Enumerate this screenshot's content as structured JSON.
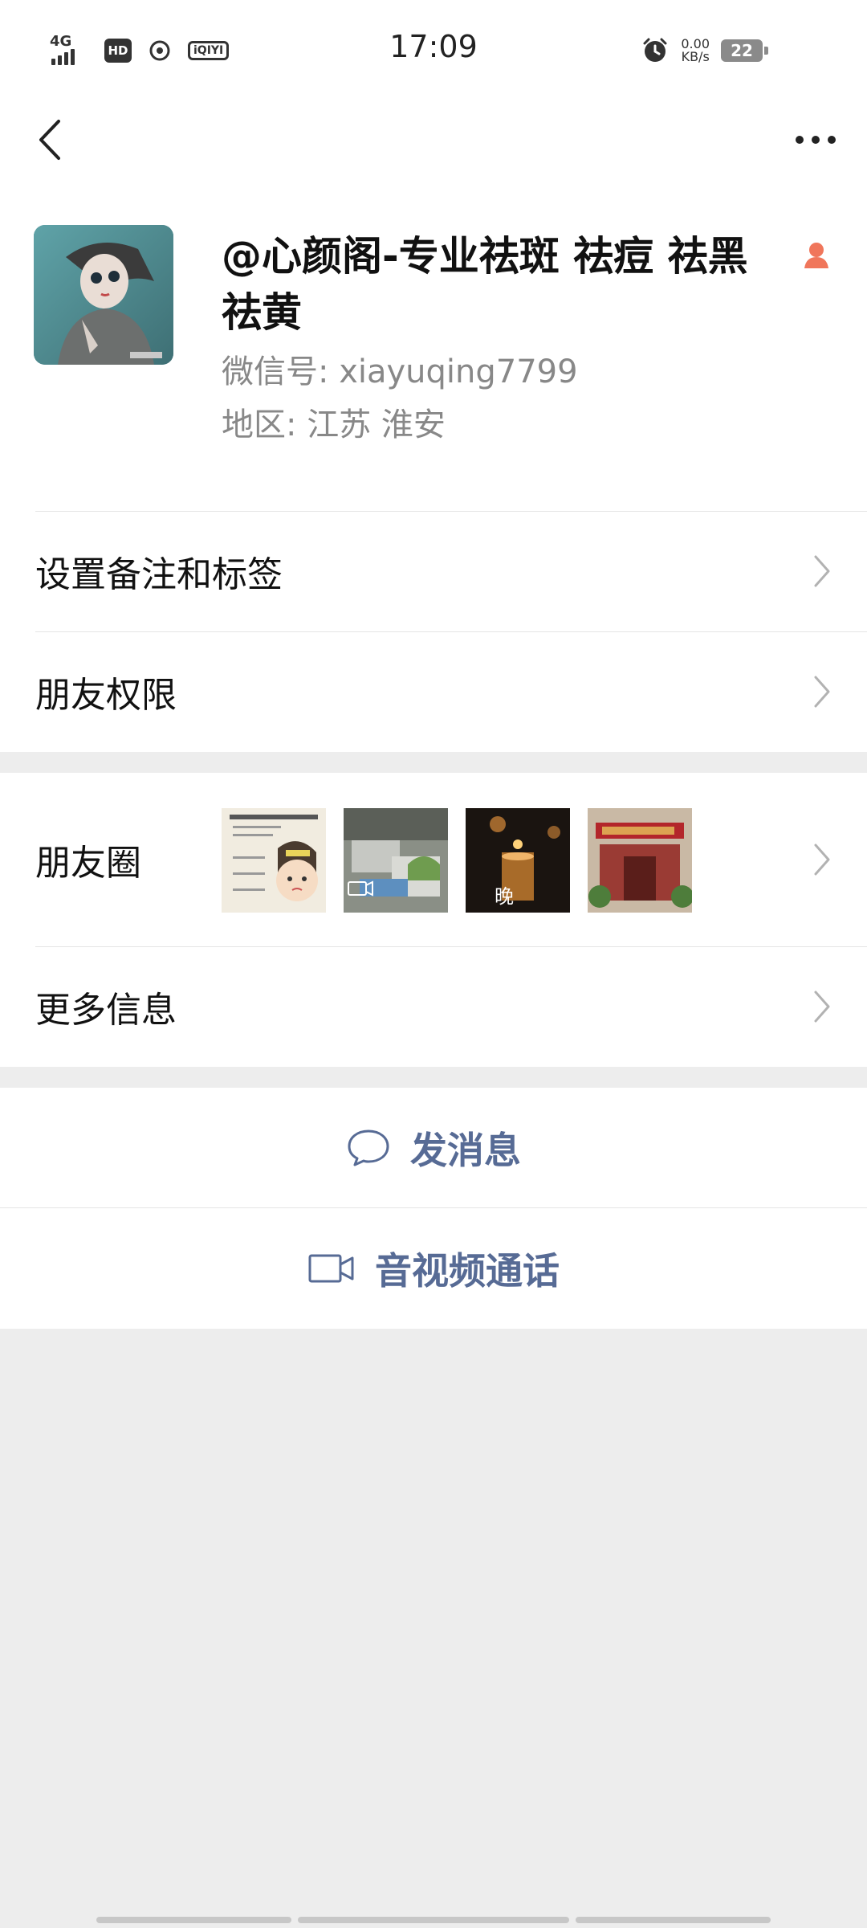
{
  "status_bar": {
    "network_label": "4G",
    "hd_label": "HD",
    "app_label": "iQIYI",
    "time": "17:09",
    "speed_value": "0.00",
    "speed_unit": "KB/s",
    "battery": "22"
  },
  "profile": {
    "name": "@心颜阁-专业祛斑 祛痘 祛黑祛黄",
    "wechat_id": "微信号: xiayuqing7799",
    "region": "地区: 江苏 淮安",
    "gender_icon_color": "#f0765b"
  },
  "menu": {
    "remark_label": "设置备注和标签",
    "permission_label": "朋友权限",
    "moments_label": "朋友圈",
    "more_info_label": "更多信息",
    "moments_thumb_text": "晚"
  },
  "actions": {
    "message_label": "发消息",
    "call_label": "音视频通话"
  },
  "colors": {
    "accent": "#576b95",
    "background": "#ededed",
    "surface": "#ffffff"
  }
}
